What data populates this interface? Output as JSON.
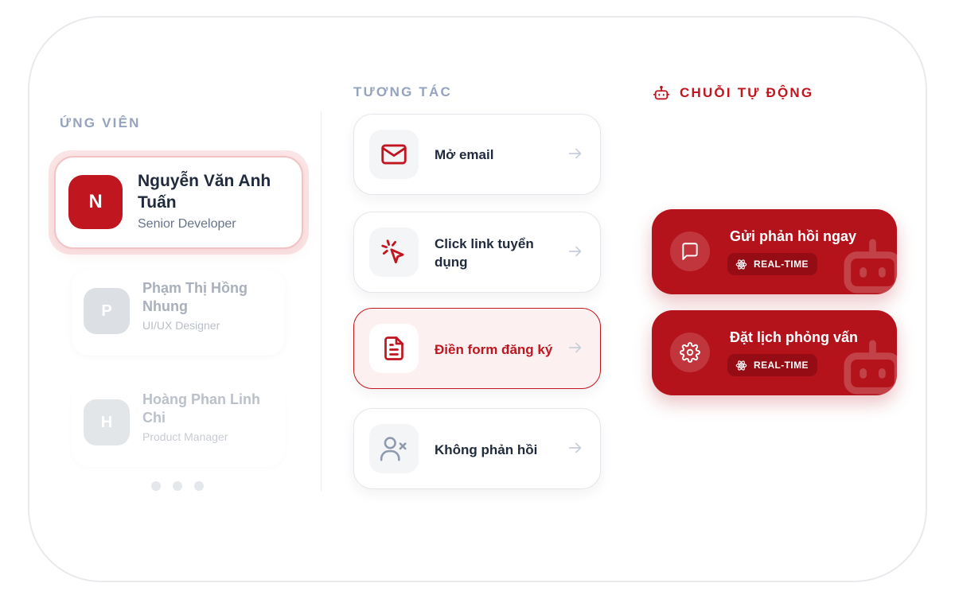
{
  "candidates": {
    "title": "ỨNG VIÊN",
    "items": [
      {
        "initial": "N",
        "name": "Nguyễn Văn Anh Tuấn",
        "role": "Senior Developer"
      },
      {
        "initial": "P",
        "name": "Phạm Thị Hồng Nhung",
        "role": "UI/UX Designer"
      },
      {
        "initial": "H",
        "name": "Hoàng Phan Linh Chi",
        "role": "Product Manager"
      }
    ]
  },
  "interactions": {
    "title": "TƯƠNG TÁC",
    "items": [
      {
        "label": "Mở email",
        "icon": "mail-icon"
      },
      {
        "label": "Click link tuyển dụng",
        "icon": "cursor-click-icon"
      },
      {
        "label": "Điền form đăng ký",
        "icon": "document-icon"
      },
      {
        "label": "Không phản hồi",
        "icon": "user-x-icon"
      }
    ]
  },
  "automation": {
    "title": "CHUỖI TỰ ĐỘNG",
    "items": [
      {
        "title": "Gửi phản hồi ngay",
        "badge": "REAL-TIME",
        "icon": "message-icon"
      },
      {
        "title": "Đặt lịch phỏng vấn",
        "badge": "REAL-TIME",
        "icon": "gear-icon"
      }
    ]
  },
  "colors": {
    "accent": "#c0161f",
    "muted": "#96a3bd"
  }
}
